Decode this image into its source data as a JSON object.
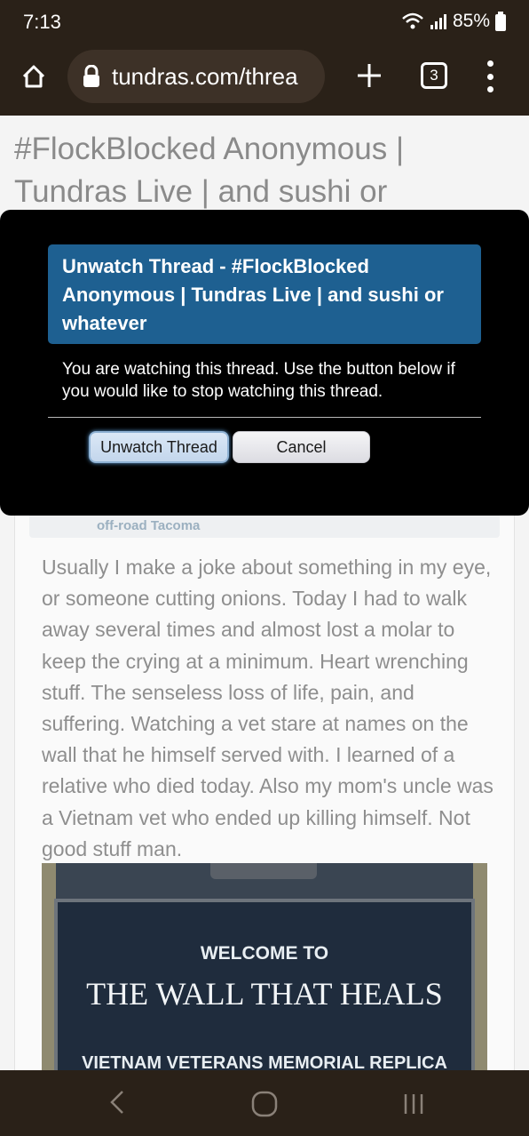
{
  "status": {
    "time": "7:13",
    "battery_percent": "85%",
    "icons": [
      "wifi-icon",
      "signal-icon",
      "battery-icon"
    ]
  },
  "browser": {
    "url": "tundras.com/threa",
    "tab_count": "3",
    "icons": [
      "home-icon",
      "lock-icon",
      "plus-icon",
      "tabs-icon",
      "more-icon"
    ]
  },
  "page": {
    "title": "#FlockBlocked Anonymous | Tundras Live | and sushi or"
  },
  "post": {
    "author_sub": "off-road Tacoma",
    "body": "Usually I make a joke about something in my eye, or someone cutting onions. Today I had to walk away several times and almost lost a molar to keep the crying at a minimum. Heart wrenching stuff. The senseless loss of life, pain, and suffering. Watching a vet stare at names on the wall that he himself served with. I learned of a relative who died today. Also my mom's uncle was a Vietnam vet who ended up killing himself. Not good stuff man.",
    "image": {
      "line1": "WELCOME TO",
      "line2": "THE WALL THAT HEALS",
      "line3": "VIETNAM VETERANS MEMORIAL REPLICA"
    }
  },
  "modal": {
    "title": "Unwatch Thread - #FlockBlocked Anonymous | Tundras Live | and sushi or whatever",
    "text": "You are watching this thread. Use the button below if you would like to stop watching this thread.",
    "primary_button": "Unwatch Thread",
    "cancel_button": "Cancel",
    "header_color": "#1e6091"
  },
  "nav": {
    "icons": [
      "back-icon",
      "home-nav-icon",
      "recent-apps-icon"
    ]
  }
}
